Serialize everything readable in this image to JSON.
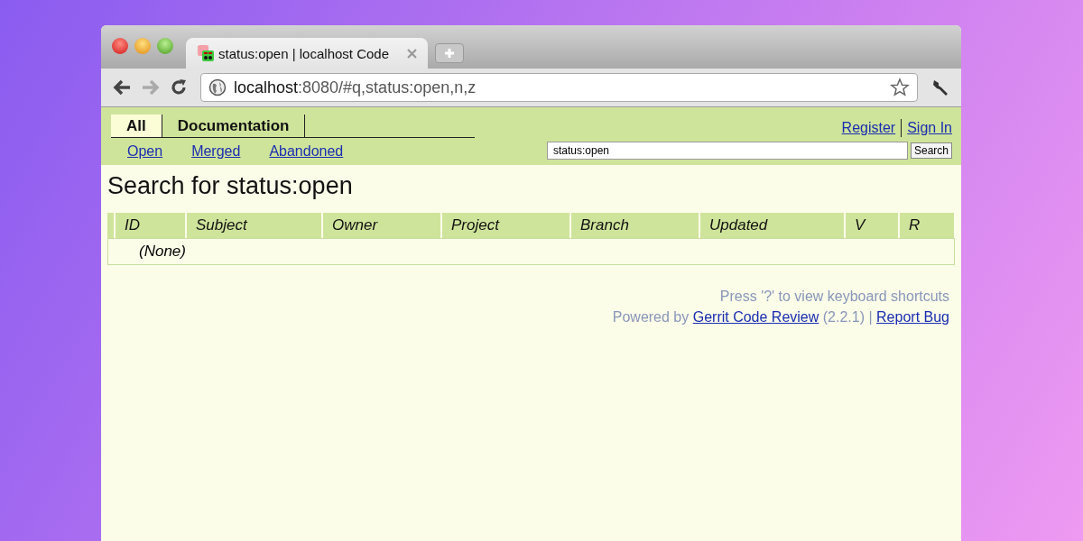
{
  "browser": {
    "tab_title": "status:open | localhost Code",
    "url_host": "localhost",
    "url_rest": ":8080/#q,status:open,n,z"
  },
  "top_tabs": [
    {
      "label": "All",
      "selected": true
    },
    {
      "label": "Documentation",
      "selected": false
    }
  ],
  "sub_links": [
    "Open",
    "Merged",
    "Abandoned"
  ],
  "account_links": [
    "Register",
    "Sign In"
  ],
  "search": {
    "value": "status:open",
    "button": "Search"
  },
  "heading": "Search for status:open",
  "table": {
    "columns": [
      "ID",
      "Subject",
      "Owner",
      "Project",
      "Branch",
      "Updated",
      "V",
      "R"
    ],
    "empty_text": "(None)"
  },
  "footer": {
    "shortcuts": "Press '?' to view keyboard shortcuts",
    "powered_by": "Powered by",
    "product_link": "Gerrit Code Review",
    "version": "(2.2.1) |",
    "report_link": "Report Bug"
  }
}
